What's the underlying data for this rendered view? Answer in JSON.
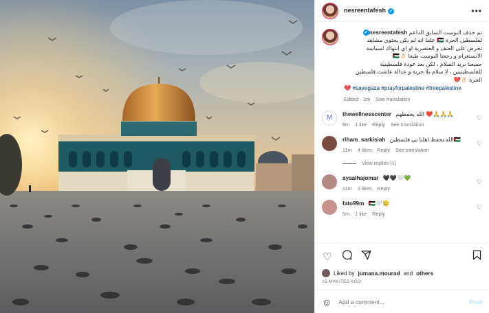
{
  "post": {
    "username": "nesreentafesh",
    "verified_glyph": "✓",
    "more_glyph": "•••"
  },
  "caption": {
    "username": "nesreentafesh",
    "lines": [
      "تم حذف البوست السابق الداعم",
      "لفلسطين الحرة 🇵🇸 علما انه لم يكن يحتوي مشاهد",
      "تحرض على العنف و العنصرية او اي انتهاك لسياسة",
      "الانستغرام و رجعنا البوست طبعا 👌🏻🇵🇸",
      "جميعنا نريد السلام ، لكن بعد عودة فلسطينية",
      "للفلسطينيين ، لا سلام بلا حرية و عدالة عاشت فلسطين",
      "الحرة 👌🏻💔"
    ],
    "hashtags": "💔 #savegaza #prayforpalestine #freepalestine",
    "edited": "Edited · 3m",
    "see_translation": "See translation"
  },
  "comments": [
    {
      "user": "thewellnesscenter",
      "text": "الله يحفظهم ❤️🙏🙏🙏",
      "time": "9m",
      "likes": "1 like",
      "reply": "Reply",
      "translate": "See translation",
      "avatar_color": "#ffffff"
    },
    {
      "user": "riham_sarkisiah",
      "text": "الله يحفظ اهلنا بي فلسطين🇵🇸",
      "time": "11m",
      "likes": "4 likes",
      "reply": "Reply",
      "translate": "See translation",
      "avatar_color": "#7a4b3f"
    },
    {
      "user": "ayaalhajomar",
      "text": "🖤🖤🤍💚",
      "time": "11m",
      "likes": "2 likes",
      "reply": "Reply",
      "translate": "",
      "avatar_color": "#b58a86"
    },
    {
      "user": "fato99m",
      "text": "🇵🇸🤍😢",
      "time": "5m",
      "likes": "1 like",
      "reply": "Reply",
      "translate": "",
      "avatar_color": "#c7918c"
    }
  ],
  "view_replies": "View replies (1)",
  "liked_by": {
    "prefix": "Liked by",
    "user": "jumana.mourad",
    "and": "and",
    "others": "others"
  },
  "timestamp": "15 MINUTES AGO",
  "add_comment": {
    "placeholder": "Add a comment...",
    "post": "Post"
  },
  "icons": {
    "like": "heart-icon",
    "comment": "comment-icon",
    "share": "share-icon",
    "save": "bookmark-icon",
    "emoji": "emoji-icon"
  }
}
